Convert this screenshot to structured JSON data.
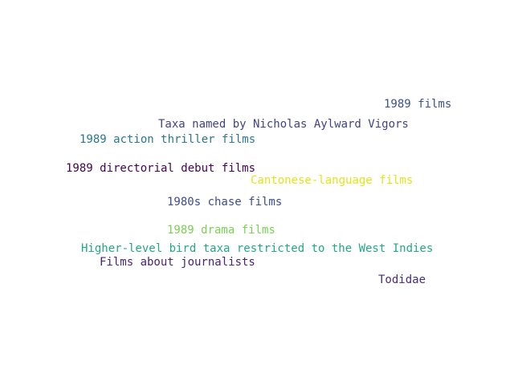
{
  "words": [
    {
      "text": "1989 films",
      "color": "#3b528b"
    },
    {
      "text": "Taxa named by Nicholas Aylward Vigors",
      "color": "#404387"
    },
    {
      "text": "1989 action thriller films",
      "color": "#2a788e"
    },
    {
      "text": "1989 directorial debut films",
      "color": "#440154"
    },
    {
      "text": "Cantonese-language films",
      "color": "#e3e418"
    },
    {
      "text": "1980s chase films",
      "color": "#3e4c8a"
    },
    {
      "text": "1989 drama films",
      "color": "#7ad151"
    },
    {
      "text": "Higher-level bird taxa restricted to the West Indies",
      "color": "#22a884"
    },
    {
      "text": "Films about journalists",
      "color": "#482475"
    },
    {
      "text": "Todidae",
      "color": "#472d7b"
    }
  ]
}
